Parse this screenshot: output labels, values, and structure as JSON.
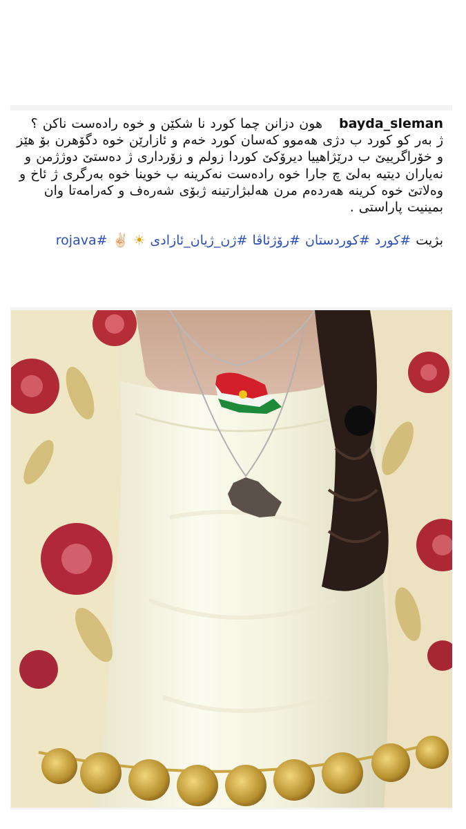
{
  "post": {
    "username": "bayda_sleman",
    "caption_lines": [
      "هون دزانن چما کورد نا شکێن و خوە رادەست ناکن ؟",
      "ژ بەر کو کورد ب دژی هەموو کەسان کورد خەم و ئازارێن خوە دگۆهرن بۆ هێز و خۆراگرییێ ب درێژاهییا دیرۆکێ کوردا زولم و زۆرداری ژ دەستێ دوژژمن و نەیاران دیتیە بەلێ چ جارا خوە رادەست نەکرینە ب خوینا خوە بەرگری ژ ئاخ و وەلاتێ خوە کرینە هەردەم مرن هەلبژارتینە ژبۆی شەرەف و کەرامەتا وان بمینیت پاراستی ."
    ],
    "hashtag_prefix": "بژیت",
    "hashtags": "#کورد #کوردستان #رۆژئاڤا #ژن_ژیان_ئازادی",
    "emoji": "☀ ✌🏻",
    "hashtag_latin": "#rojava"
  },
  "colors": {
    "background": "#ffffff",
    "card": "#f3f3f3",
    "text": "#111111",
    "hashtag": "#2a4fb8"
  },
  "photo": {
    "subject": "woman-in-cream-kurdish-dress-with-kurdistan-flag-necklace",
    "icons": [
      "kurdistan-map-pendant",
      "iraq-map-pendant",
      "red-rose-embroidery",
      "gold-coin-belt",
      "hair-braid"
    ]
  }
}
